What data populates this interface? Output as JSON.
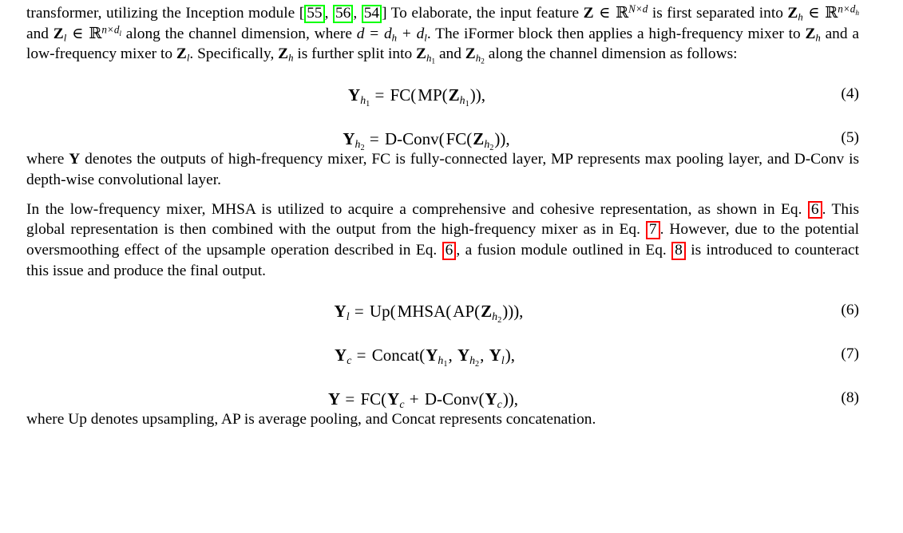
{
  "document": {
    "type": "academic-paper-excerpt",
    "highlight_colors": {
      "citation_box": "#00ff00",
      "equation_ref_box": "#ff0000"
    }
  },
  "paragraph1": {
    "seg_a": "transformer, utilizing the Inception module [",
    "citations": [
      "55",
      "56",
      "54"
    ],
    "seg_sep1": ", ",
    "seg_sep2": ", ",
    "seg_b": "] To elaborate, the input feature ",
    "math_Z": "Z",
    "in1": "∈",
    "R1": "ℝ",
    "sup1": "N×d",
    "seg_c": " is first separated into ",
    "math_Zh": "Z",
    "sub_h": "h",
    "in2": "∈",
    "R2": "ℝ",
    "sup2": "n×d",
    "sup2sub": "h",
    "seg_d": " and ",
    "math_Zl": "Z",
    "sub_l": "l",
    "in3": "∈",
    "R3": "ℝ",
    "sup3": "n×d",
    "sup3sub": "l",
    "seg_e": " along the channel dimension, where ",
    "eq_d": "d",
    "eq_equals": "=",
    "eq_dh": "d",
    "eq_dh_sub": "h",
    "eq_plus": "+",
    "eq_dl": "d",
    "eq_dl_sub": "l",
    "seg_f": ". The iFormer block then applies a high-frequency mixer to ",
    "math_Zh2": "Z",
    "sub_h2": "h",
    "seg_g": " and a low-frequency mixer to ",
    "math_Zl2": "Z",
    "sub_l2": "l",
    "seg_h": ". Specifically, ",
    "math_Zh3": "Z",
    "sub_h3": "h",
    "seg_i": " is further split into ",
    "math_Zh1a": "Z",
    "sub_h1a": "h",
    "sub_h1a_num": "1",
    "seg_j": " and ",
    "math_Zh2b": "Z",
    "sub_h2b": "h",
    "sub_h2b_num": "2",
    "seg_k": " along the channel dimension as follows:"
  },
  "equations": [
    {
      "number": "(4)",
      "lhs_base": "Y",
      "lhs_sub": "h",
      "lhs_subnum": "1",
      "equals": "=",
      "rhs_fn1": "FC(",
      "rhs_fn2": "MP(",
      "rhs_var": "Z",
      "rhs_var_sub": "h",
      "rhs_var_subnum": "1",
      "rhs_tail": ")),"
    },
    {
      "number": "(5)",
      "lhs_base": "Y",
      "lhs_sub": "h",
      "lhs_subnum": "2",
      "equals": "=",
      "rhs_fn1": "D-Conv(",
      "rhs_fn2": "FC(",
      "rhs_var": "Z",
      "rhs_var_sub": "h",
      "rhs_var_subnum": "2",
      "rhs_tail": ")),"
    },
    {
      "number": "(6)",
      "lhs_base": "Y",
      "lhs_sub": "l",
      "lhs_subnum": "",
      "equals": "=",
      "rhs_fn1": "Up(",
      "rhs_fn2": "MHSA(",
      "rhs_fn3": "AP(",
      "rhs_var": "Z",
      "rhs_var_sub": "h",
      "rhs_var_subnum": "2",
      "rhs_tail": "))),"
    },
    {
      "number": "(7)",
      "lhs_base": "Y",
      "lhs_sub": "c",
      "equals": "=",
      "rhs_fn1": "Concat(",
      "arg1": "Y",
      "arg1_sub": "h",
      "arg1_subnum": "1",
      "arg2": "Y",
      "arg2_sub": "h",
      "arg2_subnum": "2",
      "arg3": "Y",
      "arg3_sub": "l",
      "rhs_tail": "),"
    },
    {
      "number": "(8)",
      "lhs_base": "Y",
      "equals": "=",
      "rhs_fn1": "FC(",
      "arg1": "Y",
      "arg1_sub": "c",
      "plus": "+",
      "rhs_fn2": "D-Conv(",
      "arg2": "Y",
      "arg2_sub": "c",
      "rhs_tail": ")),"
    }
  ],
  "paragraph2": {
    "seg_a": "where ",
    "math_Y": "Y",
    "seg_b": " denotes the outputs of high-frequency mixer, FC is fully-connected layer, MP represents max pooling layer, and D-Conv is depth-wise convolutional layer."
  },
  "paragraph3": {
    "seg_a": "In the low-frequency mixer, MHSA is utilized to acquire a comprehensive and cohesive representation, as shown in Eq. ",
    "ref1": "6",
    "seg_b": ". This global representation is then combined with the output from the high-frequency mixer as in Eq. ",
    "ref2": "7",
    "seg_c": ". However, due to the potential oversmoothing effect of the upsample operation described in Eq. ",
    "ref3": "6",
    "seg_d": ", a fusion module outlined in Eq. ",
    "ref4": "8",
    "seg_e": " is introduced to counteract this issue and produce the final output."
  },
  "paragraph4": {
    "text": "where Up denotes upsampling, AP is average pooling, and Concat represents concatenation."
  }
}
